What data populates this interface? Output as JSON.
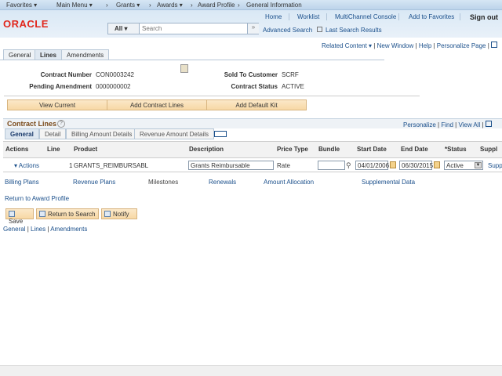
{
  "navbar": {
    "favorites": "Favorites ▾",
    "main_menu": "Main Menu ▾",
    "breadcrumb": [
      "Grants ▾",
      "Awards ▾",
      "Award Profile",
      "General Information"
    ]
  },
  "header": {
    "logo": "ORACLE",
    "links": [
      "Home",
      "Worklist",
      "MultiChannel Console",
      "Add to Favorites",
      "Sign out"
    ],
    "search_scope": "All",
    "search_placeholder": "Search",
    "advanced_search": "Advanced Search",
    "last_search": "Last Search Results"
  },
  "pagebar": {
    "related": "Related Content ▾",
    "new_window": "New Window",
    "help": "Help",
    "personalize": "Personalize Page"
  },
  "tabs": [
    "General",
    "Lines",
    "Amendments"
  ],
  "fields": {
    "contract_number_label": "Contract Number",
    "contract_number": "CON0003242",
    "pending_label": "Pending Amendment",
    "pending": "0000000002",
    "sold_to_label": "Sold To Customer",
    "sold_to": "SCRF",
    "status_label": "Contract Status",
    "status": "ACTIVE"
  },
  "buttons": [
    "View Current",
    "Add Contract Lines",
    "Add Default Kit"
  ],
  "grid": {
    "title": "Contract Lines",
    "personalize": "Personalize",
    "find": "Find",
    "view_all": "View All",
    "subtabs": [
      "General",
      "Detail",
      "Billing Amount Details",
      "Revenue Amount Details"
    ],
    "headers": [
      "Actions",
      "Line",
      "Product",
      "Description",
      "Price Type",
      "Bundle",
      "Start Date",
      "End Date",
      "*Status",
      "Suppl"
    ],
    "row": {
      "actions": "▾ Actions",
      "line": "1",
      "product": "GRANTS_REIMBURSABL",
      "description": "Grants Reimbursable",
      "price_type": "Rate",
      "bundle": "",
      "start": "04/01/2006",
      "end": "06/30/2015",
      "status": "Active",
      "supp": "Supp"
    }
  },
  "links": [
    "Billing Plans",
    "Revenue Plans",
    "Milestones",
    "Renewals",
    "Amount Allocation",
    "Supplemental Data"
  ],
  "return_link": "Return to Award Profile",
  "actions": [
    "Save",
    "Return to Search",
    "Notify"
  ],
  "footer_links": [
    "General",
    "Lines",
    "Amendments"
  ]
}
